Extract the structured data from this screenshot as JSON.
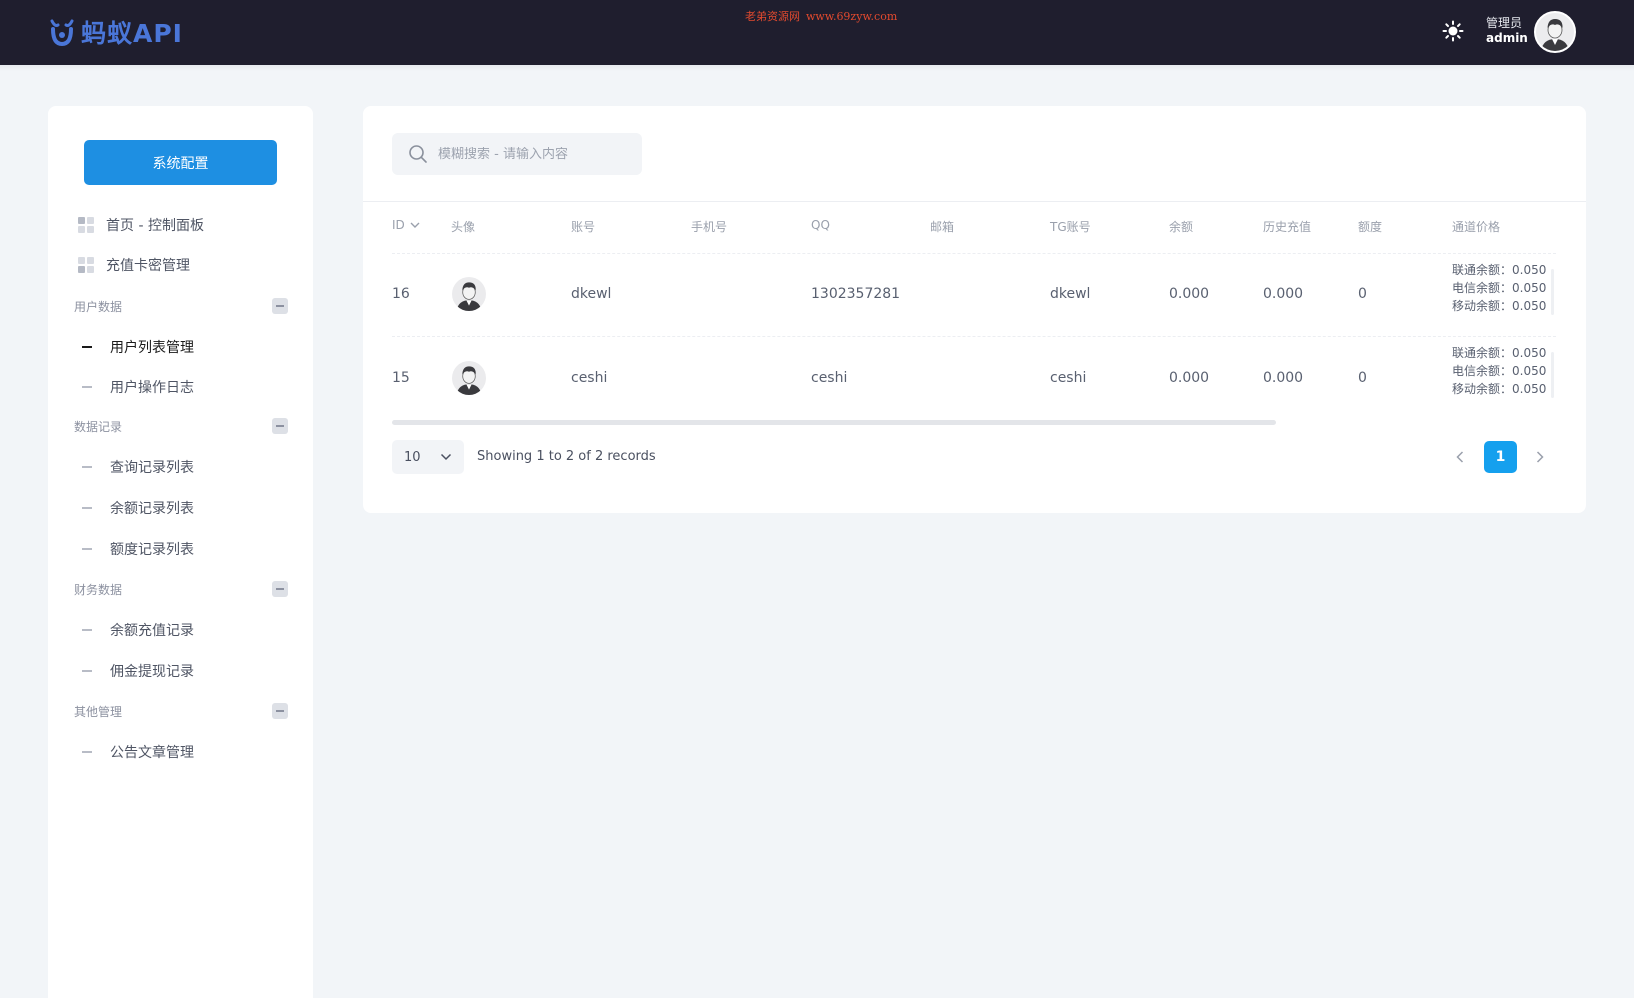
{
  "header": {
    "logo_text": "蚂蚁API",
    "watermark_cn": "老弟资源网",
    "watermark_url": "www.69zyw.com",
    "user_role": "管理员",
    "user_name": "admin"
  },
  "sidebar": {
    "config_button": "系统配置",
    "top_items": [
      {
        "label": "首页 - 控制面板",
        "icon": "dashboard-grid-icon"
      },
      {
        "label": "充值卡密管理",
        "icon": "card-grid-icon"
      }
    ],
    "groups": [
      {
        "title": "用户数据",
        "items": [
          "用户列表管理",
          "用户操作日志"
        ]
      },
      {
        "title": "数据记录",
        "items": [
          "查询记录列表",
          "余额记录列表",
          "额度记录列表"
        ]
      },
      {
        "title": "财务数据",
        "items": [
          "余额充值记录",
          "佣金提现记录"
        ]
      },
      {
        "title": "其他管理",
        "items": [
          "公告文章管理"
        ]
      }
    ],
    "active_item": "用户列表管理"
  },
  "search": {
    "placeholder": "模糊搜索 - 请输入内容",
    "value": ""
  },
  "table": {
    "columns": [
      "ID",
      "头像",
      "账号",
      "手机号",
      "QQ",
      "邮箱",
      "TG账号",
      "余额",
      "历史充值",
      "额度",
      "通道价格"
    ],
    "sort_column": "ID",
    "rows": [
      {
        "id": "16",
        "account": "dkewl",
        "phone": "",
        "qq": "1302357281",
        "email": "",
        "tg": "dkewl",
        "balance": "0.000",
        "history_recharge": "0.000",
        "quota": "0",
        "prices": [
          "联通余额：0.050",
          "电信余额：0.050",
          "移动余额：0.050"
        ]
      },
      {
        "id": "15",
        "account": "ceshi",
        "phone": "",
        "qq": "ceshi",
        "email": "",
        "tg": "ceshi",
        "balance": "0.000",
        "history_recharge": "0.000",
        "quota": "0",
        "prices": [
          "联通余额：0.050",
          "电信余额：0.050",
          "移动余额：0.050"
        ]
      }
    ]
  },
  "pagination": {
    "page_size": "10",
    "records_info": "Showing 1 to 2 of 2 records",
    "current_page": "1"
  },
  "colors": {
    "topbar_bg": "#1f1e2e",
    "primary_button": "#1e8fe2",
    "page_active": "#15a0ee",
    "logo": "#4a76d8",
    "watermark": "#e24a2e"
  }
}
